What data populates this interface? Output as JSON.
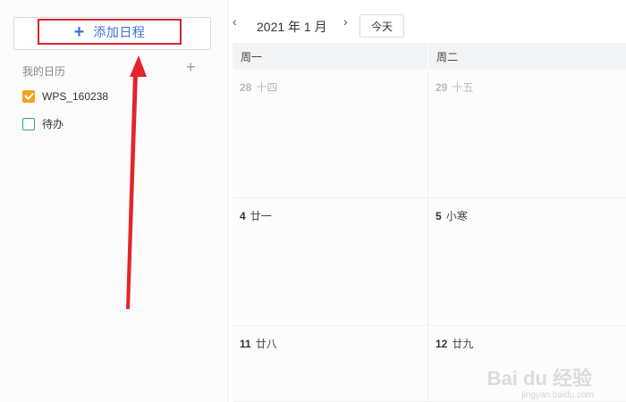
{
  "sidebar": {
    "add_event_label": "添加日程",
    "my_calendars_title": "我的日历",
    "add_calendar_icon": "plus-icon",
    "calendars": [
      {
        "label": "WPS_160238",
        "checked": true,
        "color": "#f0a41e"
      },
      {
        "label": "待办",
        "checked": false,
        "color": "#2aa394"
      }
    ]
  },
  "header": {
    "month_label": "2021 年 1 月",
    "today_label": "今天"
  },
  "grid": {
    "columns": [
      "周一",
      "周二"
    ],
    "rows": [
      [
        {
          "day": "28",
          "lunar": "十四",
          "dim": true
        },
        {
          "day": "29",
          "lunar": "十五",
          "dim": true
        }
      ],
      [
        {
          "day": "4",
          "lunar": "廿一",
          "dim": false
        },
        {
          "day": "5",
          "lunar": "小寒",
          "dim": false
        }
      ],
      [
        {
          "day": "11",
          "lunar": "廿八",
          "dim": false
        },
        {
          "day": "12",
          "lunar": "廿九",
          "dim": false
        }
      ]
    ]
  },
  "colors": {
    "accent": "#3d6fd9",
    "highlight_box": "#d9262c",
    "arrow": "#e5242b"
  },
  "watermark": {
    "brand": "Bai du 经验",
    "url": "jingyan.baidu.com"
  }
}
